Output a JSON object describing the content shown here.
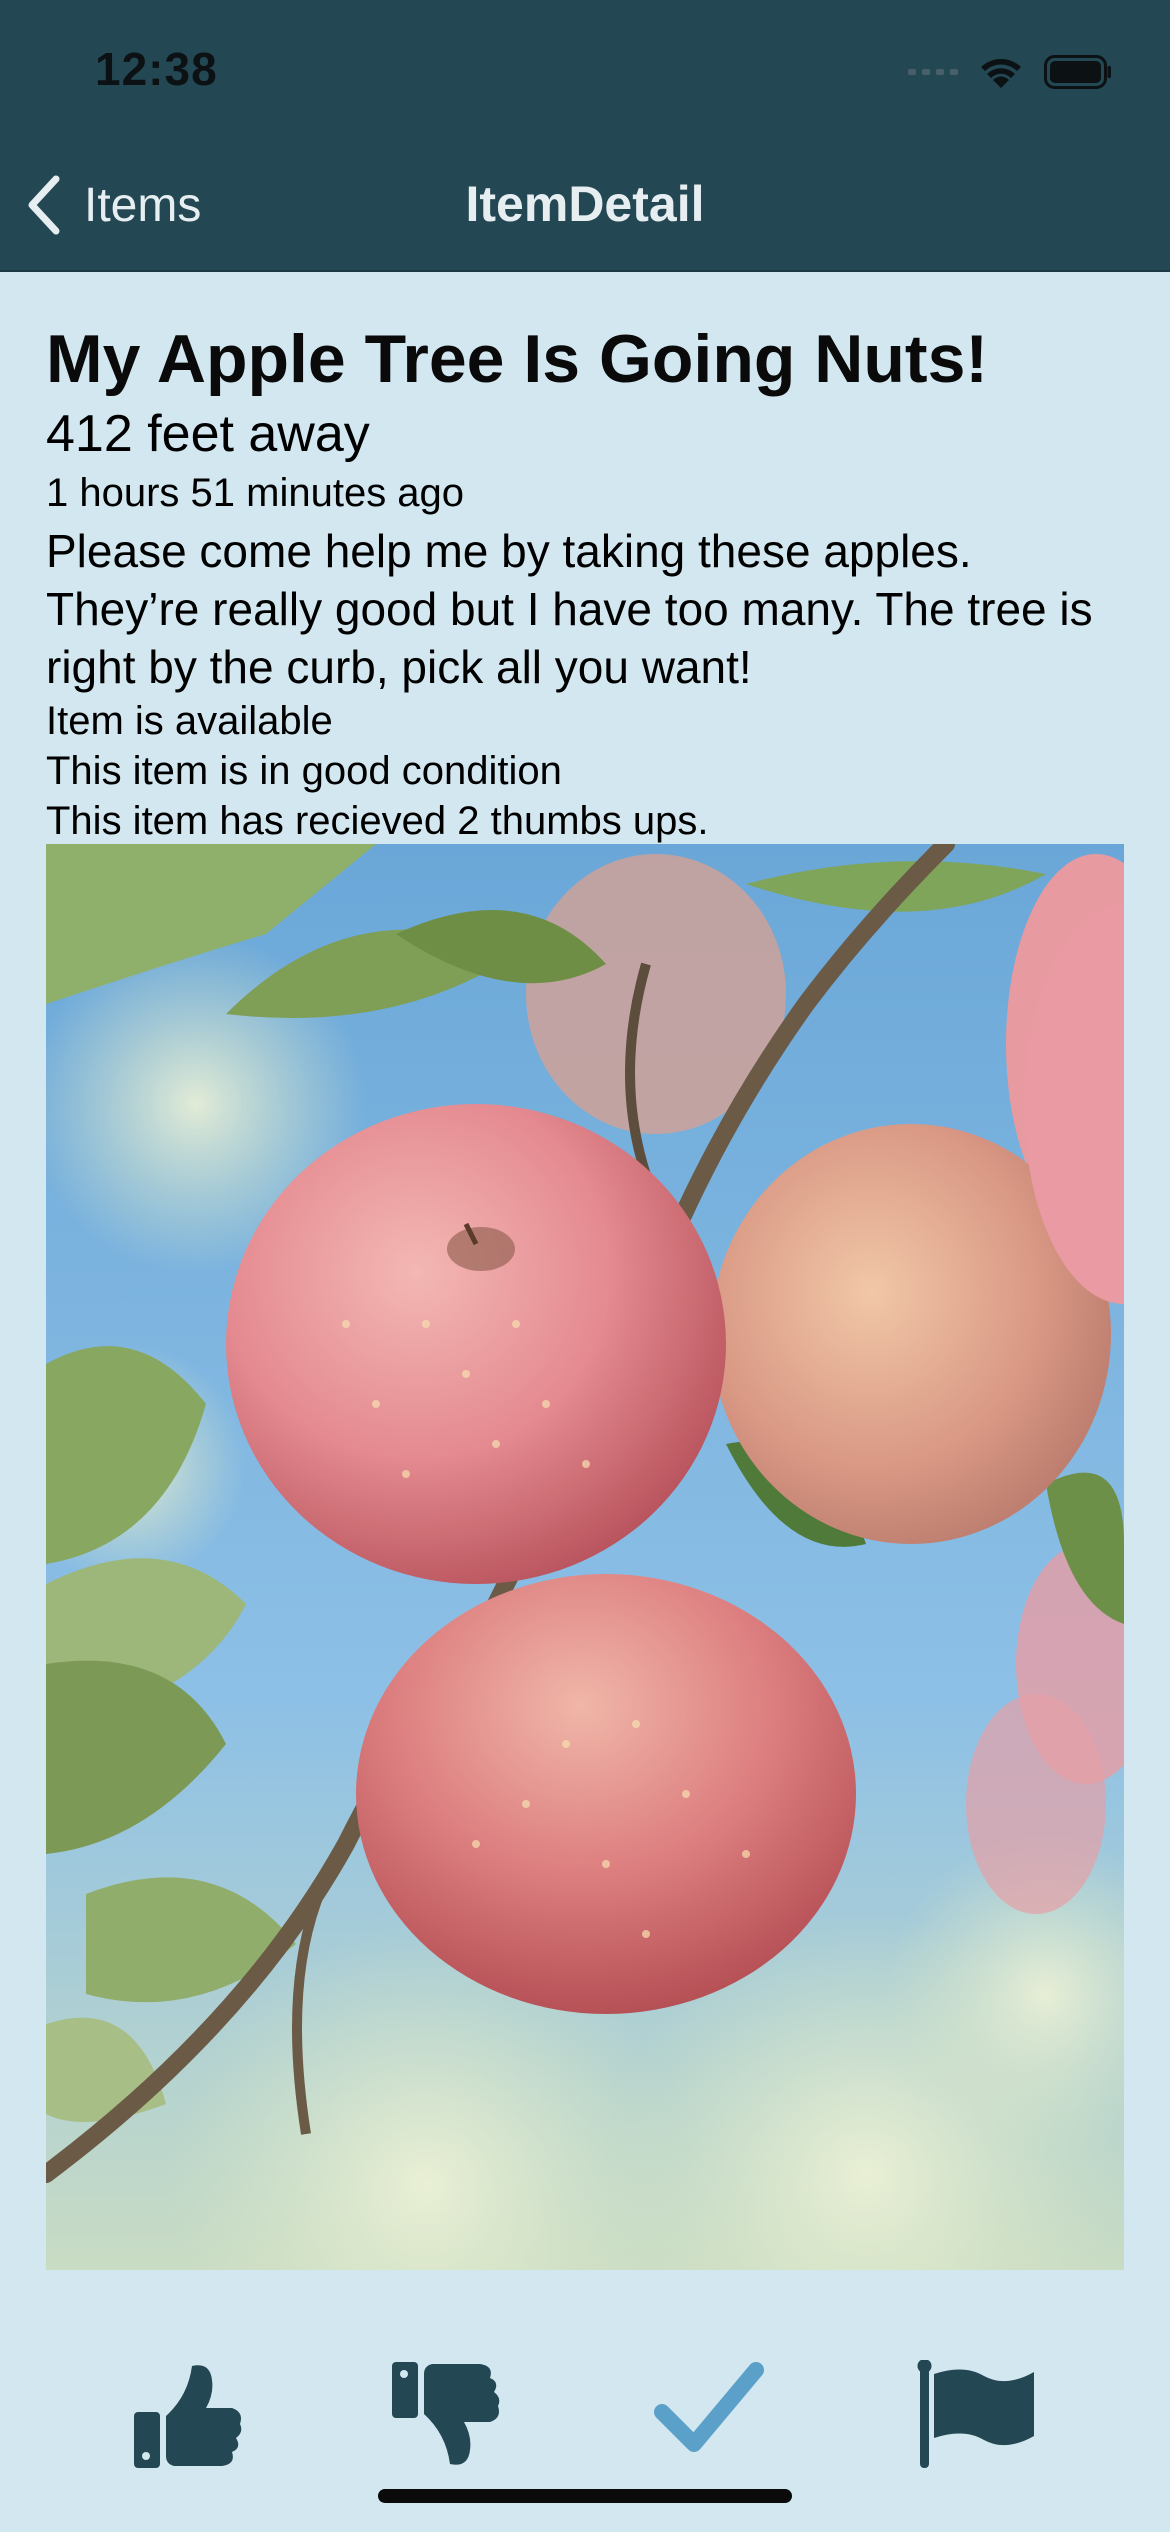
{
  "status_bar": {
    "time": "12:38"
  },
  "nav": {
    "back_label": "Items",
    "title": "ItemDetail"
  },
  "item": {
    "title": "My Apple Tree Is Going Nuts!",
    "distance": "412 feet away",
    "posted_ago": "1 hours 51 minutes ago",
    "description": "Please come help me by taking these apples. They’re really good but I have too many. The tree is right by the curb, pick all you want!",
    "availability": "Item is available",
    "condition": "This item is in good condition",
    "thumbs": "This item has recieved 2 thumbs ups."
  },
  "colors": {
    "nav_bar": "#234853",
    "background": "#d3e7f0",
    "icon_dark": "#234853",
    "icon_accent": "#5aa0c8"
  },
  "toolbar": {
    "icons": [
      "thumbs-up-icon",
      "thumbs-down-icon",
      "checkmark-icon",
      "flag-icon"
    ]
  }
}
